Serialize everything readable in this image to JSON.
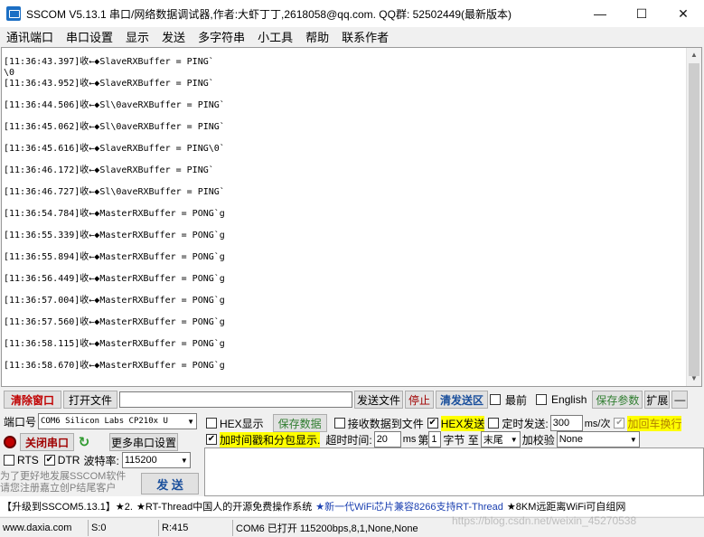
{
  "window": {
    "title": "SSCOM V5.13.1 串口/网络数据调试器,作者:大虾丁丁,2618058@qq.com. QQ群: 52502449(最新版本)",
    "minimize": "—",
    "maximize": "☐",
    "close": "✕"
  },
  "menu": [
    "通讯端口",
    "串口设置",
    "显示",
    "发送",
    "多字符串",
    "小工具",
    "帮助",
    "联系作者"
  ],
  "log": [
    "[11:36:43.397]收←◆SlaveRXBuffer = PING`",
    "\\0",
    "[11:36:43.952]收←◆SlaveRXBuffer = PING`",
    "",
    "[11:36:44.506]收←◆Sl\\0aveRXBuffer = PING`",
    "",
    "[11:36:45.062]收←◆Sl\\0aveRXBuffer = PING`",
    "",
    "[11:36:45.616]收←◆SlaveRXBuffer = PING\\0`",
    "",
    "[11:36:46.172]收←◆SlaveRXBuffer = PING`",
    "",
    "[11:36:46.727]收←◆Sl\\0aveRXBuffer = PING`",
    "",
    "[11:36:54.784]收←◆MasterRXBuffer = PONG`g",
    "",
    "[11:36:55.339]收←◆MasterRXBuffer = PONG`g",
    "",
    "[11:36:55.894]收←◆MasterRXBuffer = PONG`g",
    "",
    "[11:36:56.449]收←◆MasterRXBuffer = PONG`g",
    "",
    "[11:36:57.004]收←◆MasterRXBuffer = PONG`g",
    "",
    "[11:36:57.560]收←◆MasterRXBuffer = PONG`g",
    "",
    "[11:36:58.115]收←◆MasterRXBuffer = PONG`g",
    "",
    "[11:36:58.670]收←◆MasterRXBuffer = PONG`g"
  ],
  "toolbar": {
    "clear_window": "清除窗口",
    "open_file": "打开文件",
    "file_path": "",
    "send_file": "发送文件",
    "stop": "停止",
    "clear_send": "清发送区",
    "topmost": "最前",
    "english": "English",
    "save_params": "保存参数",
    "expand": "扩展",
    "collapse": "—"
  },
  "port": {
    "label": "端口号",
    "value": "COM6 Silicon Labs CP210x U",
    "close_port": "关闭串口",
    "more_settings": "更多串口设置",
    "rts": "RTS",
    "dtr": "DTR",
    "baud_label": "波特率:",
    "baud_value": "115200",
    "promo_line1": "为了更好地发展SSCOM软件",
    "promo_line2": "请您注册嘉立创P结尾客户",
    "send_button": "发  送"
  },
  "options": {
    "hex_display": "HEX显示",
    "save_data": "保存数据",
    "recv_to_file": "接收数据到文件",
    "hex_send": "HEX发送",
    "timed_send": "定时发送:",
    "interval": "300",
    "interval_unit": "ms/次",
    "add_crlf": "加回车换行",
    "add_timestamp": "加时间戳和分包显示.",
    "timeout_label": "超时时间:",
    "timeout_value": "20",
    "timeout_unit": "ms",
    "byte_prefix": "第",
    "byte_index": "1",
    "byte_to": "字节 至",
    "byte_end": "末尾",
    "checksum_label": "加校验",
    "checksum_value": "None"
  },
  "adbar": [
    "【升级到SSCOM5.13.1】★2.",
    "★RT-Thread中国人的开源免费操作系统",
    "★新一代WiFi芯片兼容8266支持RT-Thread",
    "★8KM远距离WiFi可自组网"
  ],
  "status": {
    "site": "www.daxia.com",
    "sent": "S:0",
    "received": "R:415",
    "port_state": "COM6 已打开  115200bps,8,1,None,None"
  },
  "watermark": "https://blog.csdn.net/weixin_45270538"
}
